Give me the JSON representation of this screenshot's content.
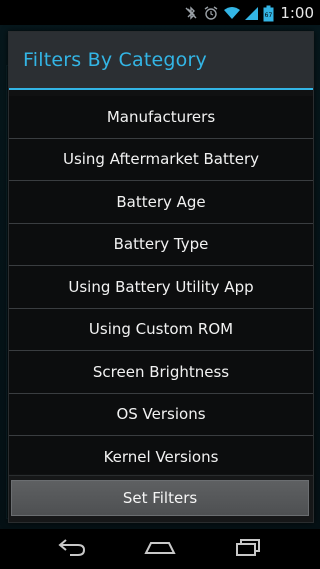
{
  "status_bar": {
    "time": "1:00",
    "icons": [
      "bluetooth-off-icon",
      "alarm-icon",
      "wifi-icon",
      "signal-icon",
      "battery-icon"
    ],
    "battery_label": "67"
  },
  "dialog": {
    "title": "Filters By Category",
    "accent_color": "#33b5e5",
    "items": [
      {
        "label": "Manufacturers"
      },
      {
        "label": "Using Aftermarket Battery"
      },
      {
        "label": "Battery Age"
      },
      {
        "label": "Battery Type"
      },
      {
        "label": "Using Battery Utility App"
      },
      {
        "label": "Using Custom ROM"
      },
      {
        "label": "Screen Brightness"
      },
      {
        "label": "OS Versions"
      },
      {
        "label": "Kernel Versions"
      }
    ],
    "action_label": "Set Filters"
  },
  "nav_bar": {
    "buttons": [
      "back-icon",
      "home-icon",
      "recent-apps-icon"
    ]
  }
}
